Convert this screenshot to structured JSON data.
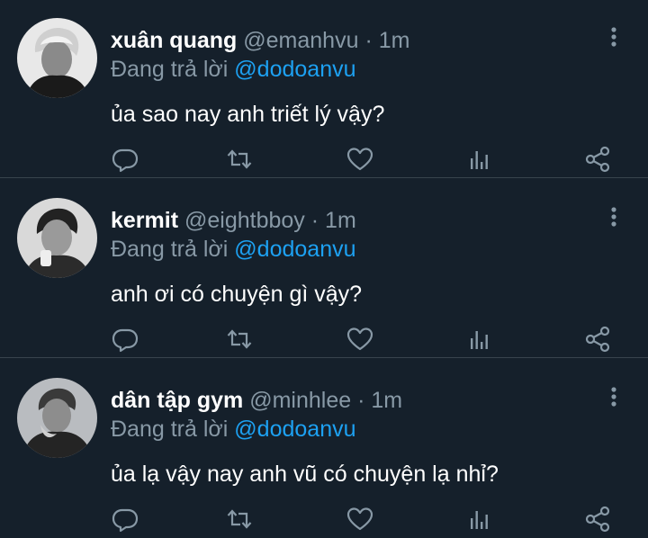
{
  "tweets": [
    {
      "name": "xuân quang",
      "handle": "@emanhvu",
      "dot": "·",
      "time": "1m",
      "reply_prefix": "Đang trả lời",
      "reply_to": "@dodoanvu",
      "text": "ủa sao nay anh triết lý vậy?"
    },
    {
      "name": "kermit",
      "handle": "@eightbboy",
      "dot": "·",
      "time": "1m",
      "reply_prefix": "Đang trả lời",
      "reply_to": "@dodoanvu",
      "text": "anh ơi có chuyện gì vậy?"
    },
    {
      "name": "dân tập gym",
      "handle": "@minhlee",
      "dot": "·",
      "time": "1m",
      "reply_prefix": "Đang trả lời",
      "reply_to": "@dodoanvu",
      "text": "ủa lạ vậy nay anh vũ có chuyện lạ nhỉ?"
    }
  ],
  "icons": {
    "reply": "reply-icon",
    "retweet": "retweet-icon",
    "like": "heart-icon",
    "stats": "analytics-icon",
    "share": "share-icon",
    "more": "more-vertical-icon"
  },
  "colors": {
    "background": "#15202b",
    "divider": "#38444d",
    "secondary_text": "#8899a6",
    "mention": "#1da1f2",
    "icon": "#8899a6"
  }
}
